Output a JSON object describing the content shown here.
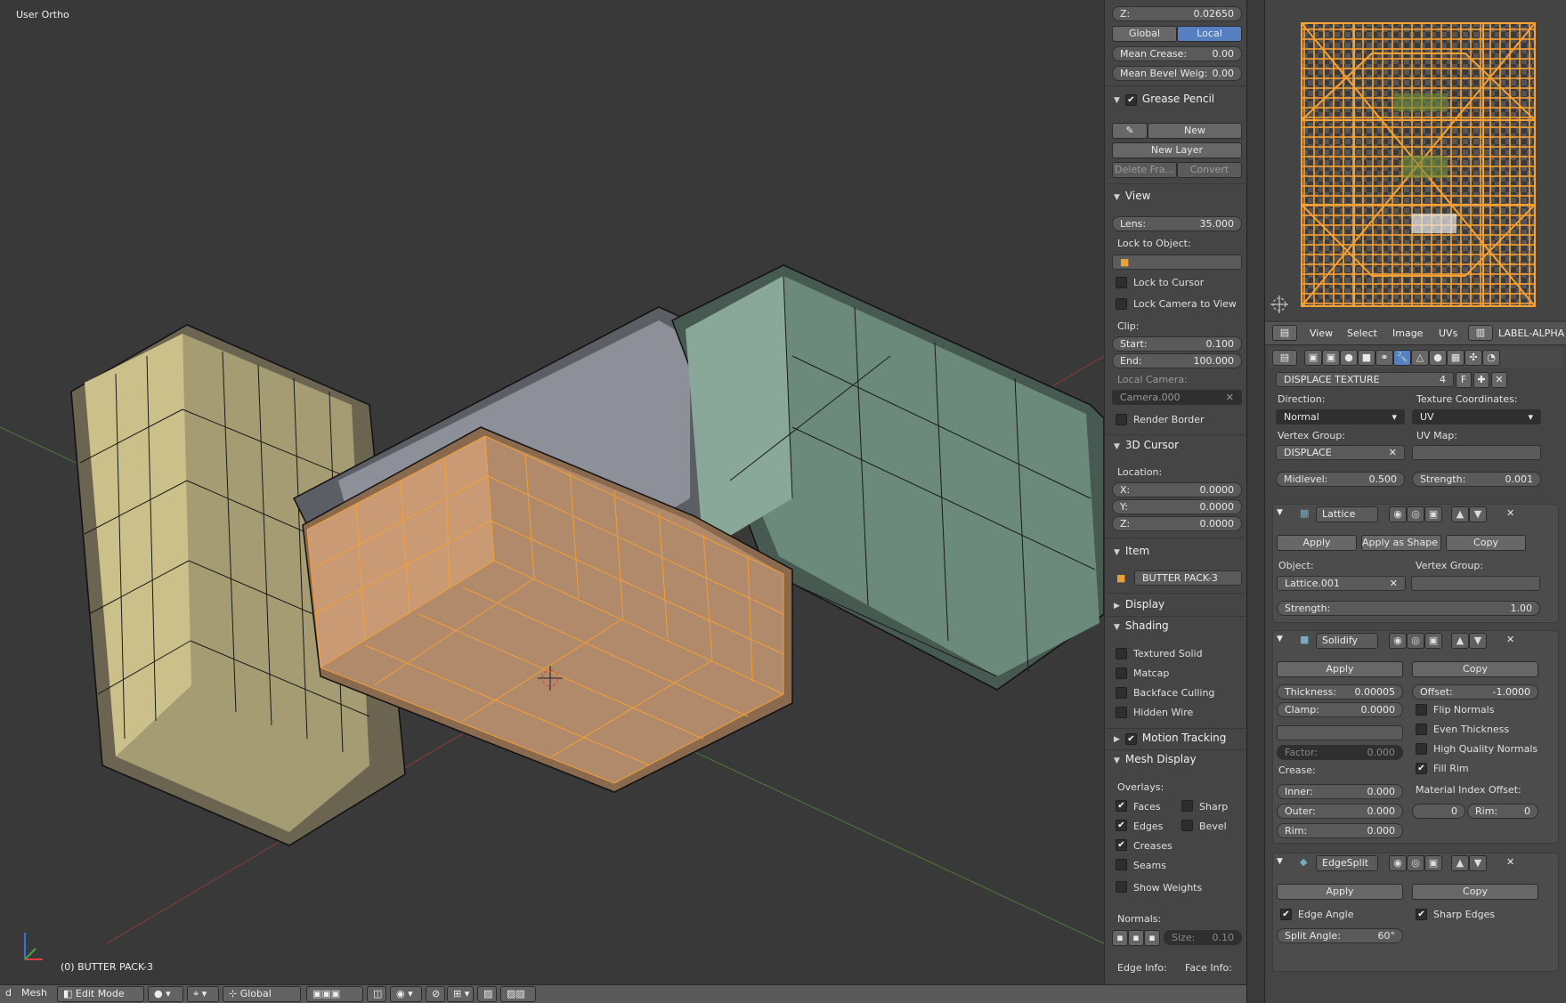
{
  "viewport": {
    "view_name": "User Ortho",
    "object_info": "(0) BUTTER PACK-3"
  },
  "npanel": {
    "z_field": {
      "label": "Z:",
      "value": "0.02650"
    },
    "global_btn": "Global",
    "local_btn": "Local",
    "mean_crease": {
      "label": "Mean Crease:",
      "value": "0.00"
    },
    "mean_bevel": {
      "label": "Mean Bevel Weig:",
      "value": "0.00"
    },
    "grease_pencil": {
      "title": "Grease Pencil",
      "new_btn": "New",
      "new_layer_btn": "New Layer",
      "delete_frame_btn": "Delete Fra...",
      "convert_btn": "Convert"
    },
    "view": {
      "title": "View",
      "lens": {
        "label": "Lens:",
        "value": "35.000"
      },
      "lock_to_object": "Lock to Object:",
      "lock_to_cursor": "Lock to Cursor",
      "lock_camera": "Lock Camera to View",
      "clip": "Clip:",
      "start": {
        "label": "Start:",
        "value": "0.100"
      },
      "end": {
        "label": "End:",
        "value": "100.000"
      },
      "local_camera": "Local Camera:",
      "camera_value": "Camera.000",
      "render_border": "Render Border"
    },
    "cursor": {
      "title": "3D Cursor",
      "location": "Location:",
      "x": {
        "label": "X:",
        "value": "0.0000"
      },
      "y": {
        "label": "Y:",
        "value": "0.0000"
      },
      "z": {
        "label": "Z:",
        "value": "0.0000"
      }
    },
    "item": {
      "title": "Item",
      "name": "BUTTER PACK-3"
    },
    "display": {
      "title": "Display"
    },
    "shading": {
      "title": "Shading",
      "textured_solid": "Textured Solid",
      "matcap": "Matcap",
      "backface": "Backface Culling",
      "hidden_wire": "Hidden Wire"
    },
    "motion_tracking": {
      "title": "Motion Tracking"
    },
    "mesh_display": {
      "title": "Mesh Display",
      "overlays": "Overlays:",
      "faces": "Faces",
      "sharp": "Sharp",
      "edges": "Edges",
      "bevel": "Bevel",
      "creases": "Creases",
      "seams": "Seams",
      "show_weights": "Show Weights",
      "normals": "Normals:",
      "size": {
        "label": "Size:",
        "value": "0.10"
      },
      "edge_info": "Edge Info:",
      "face_info": "Face Info:"
    }
  },
  "uv_header": {
    "view": "View",
    "select": "Select",
    "image": "Image",
    "uvs": "UVs",
    "image_name": "LABEL-ALPHA"
  },
  "props": {
    "displace": {
      "name": "DISPLACE TEXTURE",
      "users": "4",
      "fake": "F",
      "direction_label": "Direction:",
      "direction_value": "Normal",
      "texcoords_label": "Texture Coordinates:",
      "texcoords_value": "UV",
      "vgroup_label": "Vertex Group:",
      "vgroup_value": "DISPLACE",
      "uvmap_label": "UV Map:",
      "midlevel": {
        "label": "Midlevel:",
        "value": "0.500"
      },
      "strength": {
        "label": "Strength:",
        "value": "0.001"
      }
    },
    "lattice": {
      "name": "Lattice",
      "apply": "Apply",
      "apply_shape": "Apply as Shape ...",
      "copy": "Copy",
      "object_label": "Object:",
      "object_value": "Lattice.001",
      "vgroup_label": "Vertex Group:",
      "strength": {
        "label": "Strength:",
        "value": "1.00"
      }
    },
    "solidify": {
      "name": "Solidify",
      "apply": "Apply",
      "copy": "Copy",
      "thickness": {
        "label": "Thickness:",
        "value": "0.00005"
      },
      "offset": {
        "label": "Offset:",
        "value": "-1.0000"
      },
      "clamp": {
        "label": "Clamp:",
        "value": "0.0000"
      },
      "flip_normals": "Flip Normals",
      "even_thickness": "Even Thickness",
      "high_quality": "High Quality Normals",
      "fill_rim": "Fill Rim",
      "factor": {
        "label": "Factor:",
        "value": "0.000"
      },
      "crease_label": "Crease:",
      "inner": {
        "label": "Inner:",
        "value": "0.000"
      },
      "outer": {
        "label": "Outer:",
        "value": "0.000"
      },
      "rim": {
        "label": "Rim:",
        "value": "0.000"
      },
      "mat_index_label": "Material Index Offset:",
      "mat_index_value": "0",
      "mat_rim": {
        "label": "Rim:",
        "value": "0"
      }
    },
    "edgesplit": {
      "name": "EdgeSplit",
      "apply": "Apply",
      "copy": "Copy",
      "edge_angle": "Edge Angle",
      "sharp_edges": "Sharp Edges",
      "split_angle": {
        "label": "Split Angle:",
        "value": "60°"
      }
    }
  },
  "bottombar": {
    "view_menu": "d",
    "mesh_menu": "Mesh",
    "mode": "Edit Mode",
    "orientation": "Global"
  },
  "colors": {
    "selection": "#f7a033",
    "viewport_bg": "#393939",
    "panel_bg": "#454545"
  }
}
